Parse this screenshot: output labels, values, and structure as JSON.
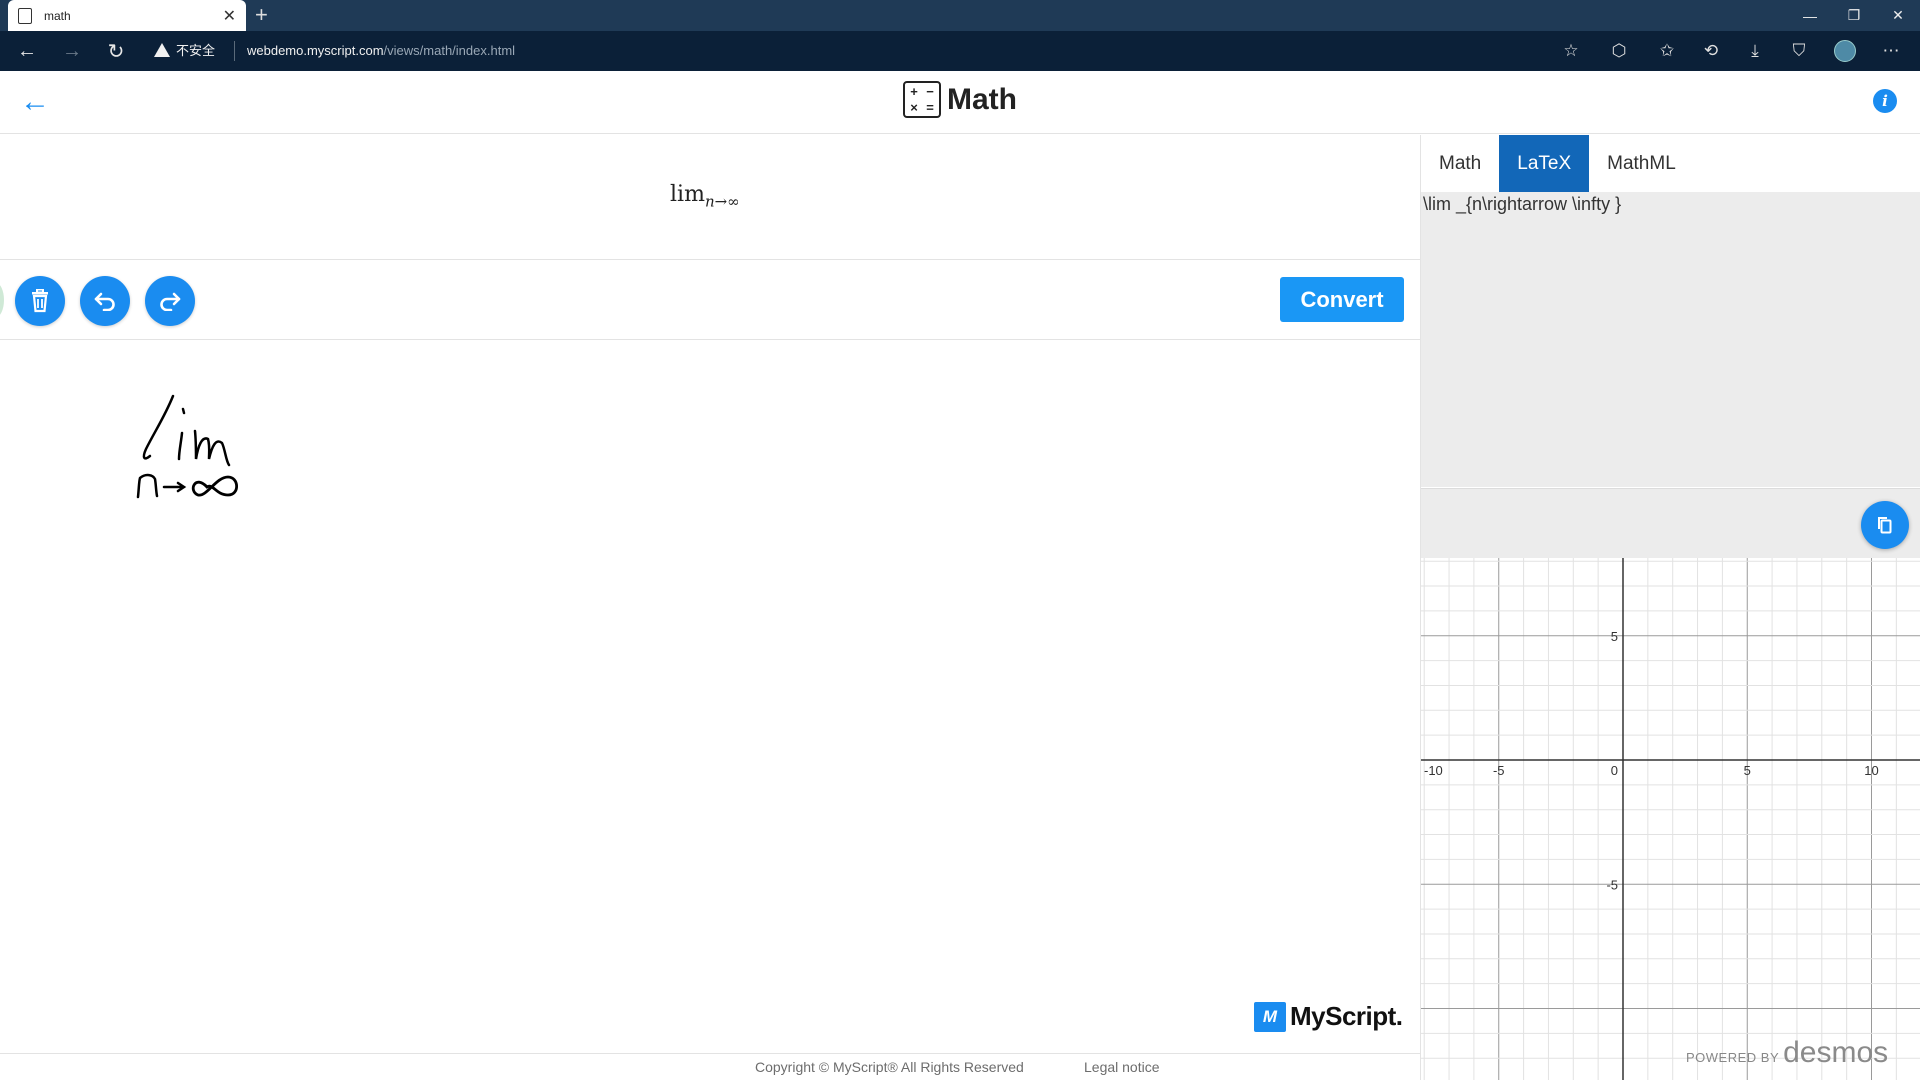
{
  "browser": {
    "tab_title": "math",
    "security_label": "不安全",
    "url_host": "webdemo.myscript.com",
    "url_path": "/views/math/index.html"
  },
  "header": {
    "app_name": "Math",
    "logo_symbols": [
      "+",
      "−",
      "×",
      "="
    ]
  },
  "result": {
    "expr_main": "lim",
    "expr_sub": "n→∞"
  },
  "toolbar": {
    "convert_label": "Convert"
  },
  "ink": {
    "line1": "lim",
    "line2": "n→∞"
  },
  "brand": {
    "myscript_mark": "M",
    "myscript_word": "MyScript."
  },
  "footer": {
    "copyright": "Copyright © MyScript® All Rights Reserved",
    "legal": "Legal notice"
  },
  "output": {
    "tabs": [
      "Math",
      "LaTeX",
      "MathML"
    ],
    "active_tab": "LaTeX",
    "latex": "\\lim _{n\\rightarrow \\infty }"
  },
  "graph": {
    "x_ticks": [
      "-10",
      "-5",
      "0",
      "5",
      "10"
    ],
    "y_ticks": [
      "5",
      "-5"
    ],
    "x_range": [
      -10,
      10
    ],
    "y_range": [
      -10,
      10
    ],
    "powered_by": "POWERED BY",
    "powered_brand": "desmos"
  },
  "colors": {
    "accent": "#1a8cf0",
    "active_tab": "#1267b8",
    "chrome": "#0b2038"
  }
}
